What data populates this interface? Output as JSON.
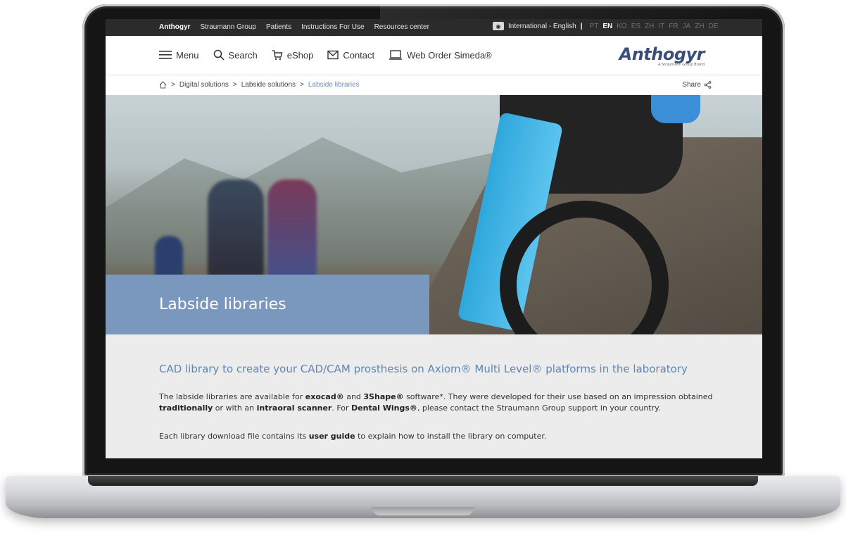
{
  "topbar": {
    "links": [
      "Anthogyr",
      "Straumann Group",
      "Patients",
      "Instructions For Use",
      "Resources center"
    ],
    "region": "International - English",
    "languages": [
      "PT",
      "EN",
      "KO",
      "ES",
      "ZH",
      "IT",
      "FR",
      "JA",
      "ZH",
      "DE"
    ],
    "active_language": "EN"
  },
  "nav": {
    "menu": "Menu",
    "search": "Search",
    "eshop": "eShop",
    "contact": "Contact",
    "web_order": "Web Order Simeda®"
  },
  "logo": {
    "text": "Anthogyr",
    "subtitle": "A Straumann Group Brand"
  },
  "breadcrumb": {
    "items": [
      "Digital solutions",
      "Labside solutions"
    ],
    "current": "Labside libraries",
    "share": "Share"
  },
  "hero": {
    "title": "Labside libraries"
  },
  "content": {
    "subtitle": "CAD library to create your CAD/CAM prosthesis on Axiom® Multi Level® platforms in the laboratory",
    "p1": {
      "t1": "The labside libraries are available for ",
      "b1": "exocad®",
      "t2": " and ",
      "b2": "3Shape®",
      "t3": " software*. They were developed for their use based on an impression obtained ",
      "b3": "traditionally",
      "t4": " or with an ",
      "b4": "intraoral scanner",
      "t5": ". For ",
      "b5": "Dental Wings®",
      "t6": ", please contact the Straumann Group support in your country."
    },
    "p2": {
      "t1": "Each library download file contains its ",
      "b1": "user guide",
      "t2": " to explain how to install the library on computer."
    }
  },
  "colors": {
    "accent": "#7a98bd",
    "subtitle": "#5f86b3",
    "topbar": "#2b2b2b",
    "bike_frame": "#2fa7dc"
  },
  "icons": [
    "home-icon",
    "menu-icon",
    "search-icon",
    "cart-icon",
    "mail-icon",
    "laptop-icon",
    "share-icon",
    "globe-icon"
  ]
}
